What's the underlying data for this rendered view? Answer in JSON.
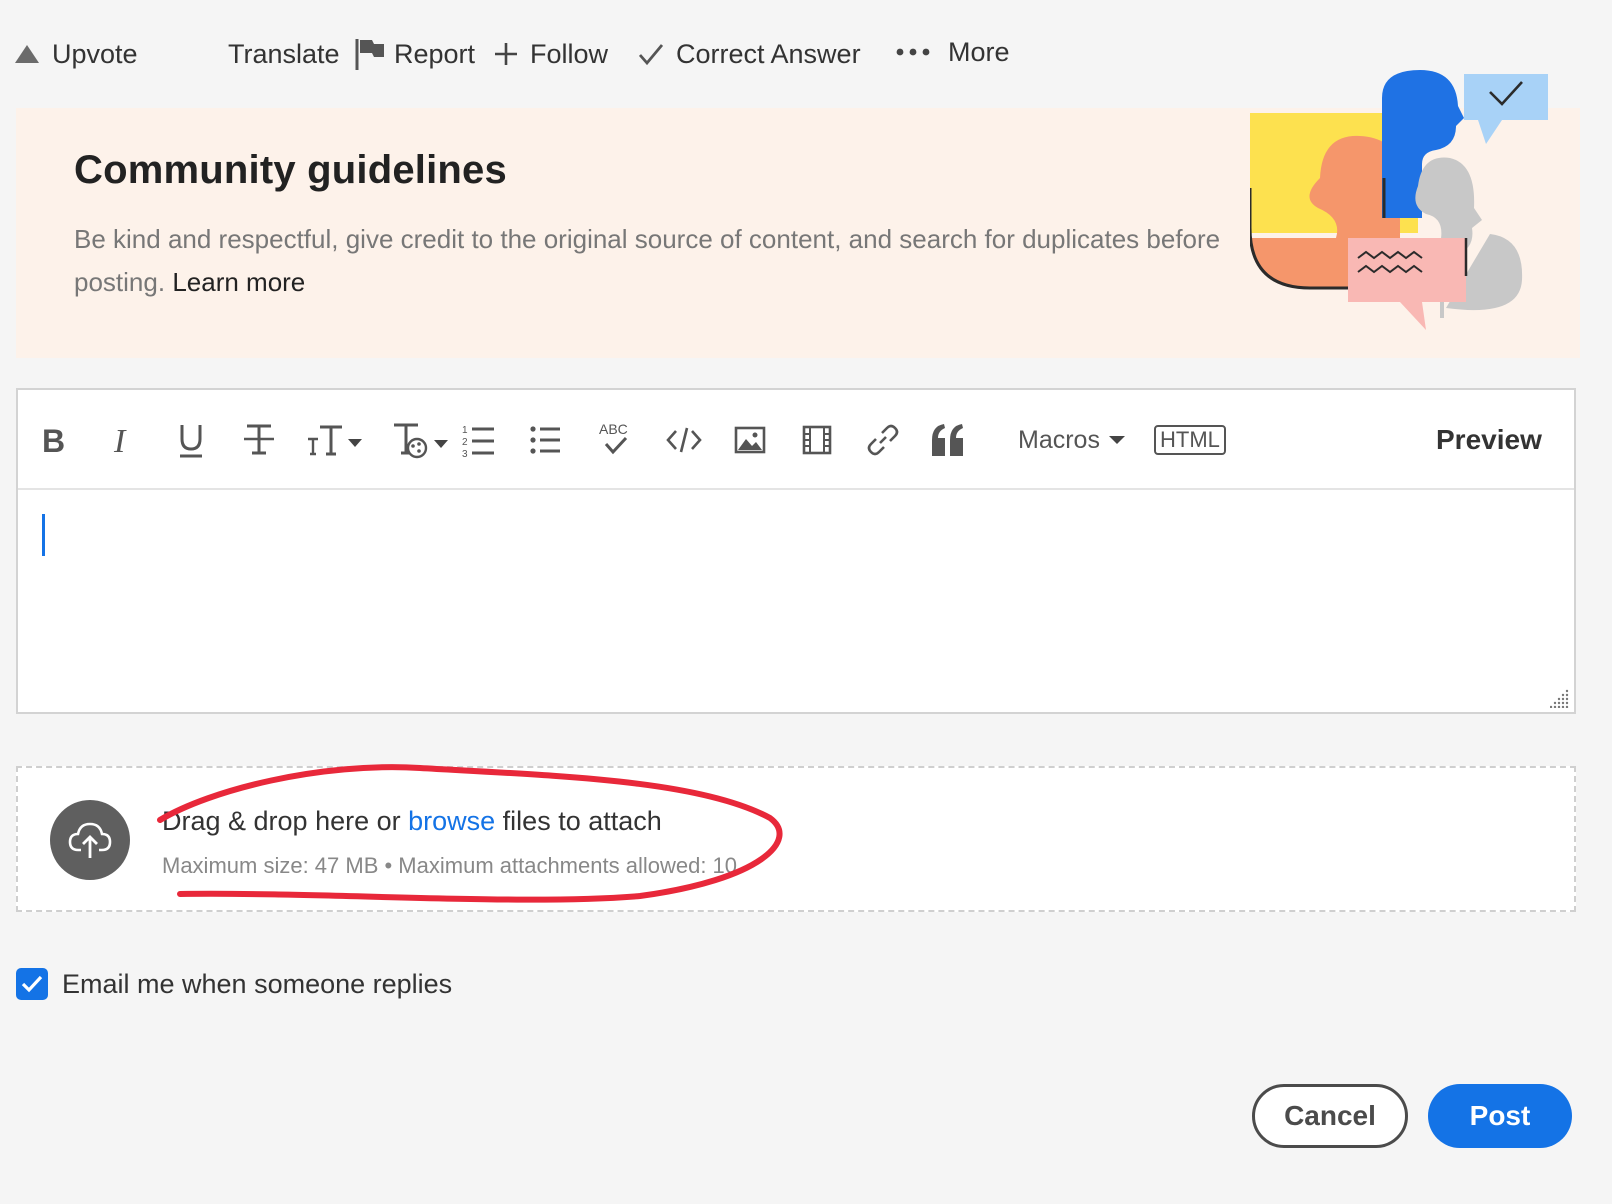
{
  "actions": {
    "upvote": "Upvote",
    "translate": "Translate",
    "report": "Report",
    "follow": "Follow",
    "correct_answer": "Correct Answer",
    "more": "More"
  },
  "guidelines": {
    "title": "Community guidelines",
    "text": "Be kind and respectful, give credit to the original source of content, and search for duplicates before posting.",
    "link": "Learn more"
  },
  "toolbar": {
    "macros": "Macros",
    "html": "HTML",
    "preview": "Preview",
    "spell_label": "ABC"
  },
  "dropzone": {
    "prefix": "Drag & drop here or ",
    "browse": "browse",
    "suffix": " files to attach",
    "limits": "Maximum size: 47 MB • Maximum attachments allowed: 10"
  },
  "email_option": {
    "label": "Email me when someone replies",
    "checked": true
  },
  "buttons": {
    "cancel": "Cancel",
    "post": "Post"
  },
  "colors": {
    "accent": "#1473e6",
    "banner_bg": "#fdf2ea",
    "annotation": "#e8283a"
  }
}
